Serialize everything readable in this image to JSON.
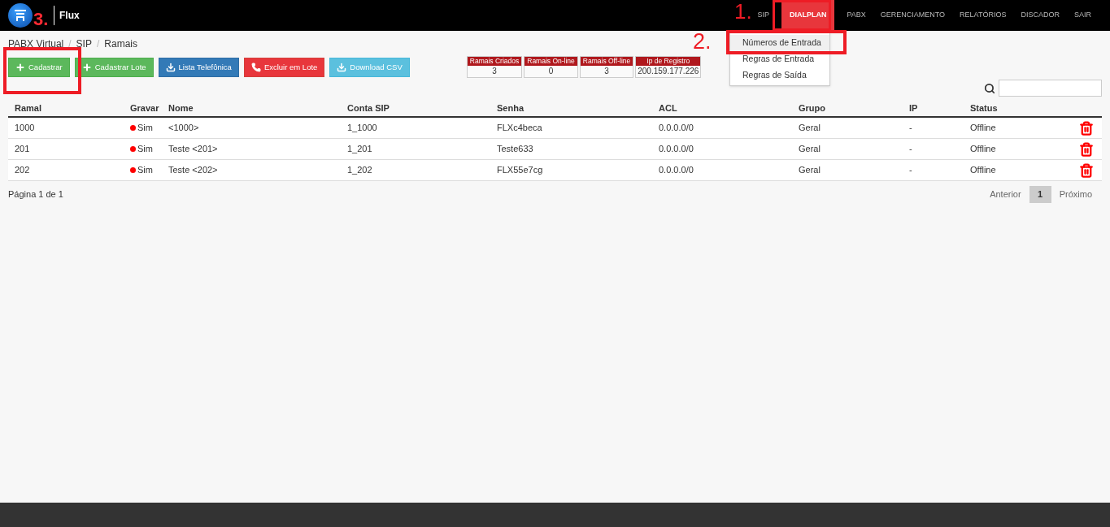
{
  "brand": "Flux",
  "nav": [
    {
      "label": "SIP",
      "selected": false
    },
    {
      "label": "DIALPLAN",
      "selected": true
    },
    {
      "label": "PABX",
      "selected": false
    },
    {
      "label": "GERENCIAMENTO",
      "selected": false
    },
    {
      "label": "RELATÓRIOS",
      "selected": false
    },
    {
      "label": "DISCADOR",
      "selected": false
    },
    {
      "label": "SAIR",
      "selected": false
    }
  ],
  "dropdown": [
    {
      "label": "Números de Entrada",
      "selected": true
    },
    {
      "label": "Regras de Entrada",
      "selected": false
    },
    {
      "label": "Regras de Saída",
      "selected": false
    }
  ],
  "breadcrumb": [
    "PABX Virtual",
    "SIP",
    "Ramais"
  ],
  "breadcrumb_separator": "/",
  "buttons": [
    {
      "label": "Cadastrar",
      "kind": "add"
    },
    {
      "label": "Cadastrar Lote",
      "kind": "add"
    },
    {
      "label": "Lista Telefônica",
      "kind": "list"
    },
    {
      "label": "Excluir em Lote",
      "kind": "delete"
    },
    {
      "label": "Download CSV",
      "kind": "download"
    }
  ],
  "stats": [
    {
      "label": "Ramais Criados",
      "value": "3"
    },
    {
      "label": "Ramais On-line",
      "value": "0"
    },
    {
      "label": "Ramais Off-line",
      "value": "3"
    },
    {
      "label": "Ip de Registro",
      "value": "200.159.177.226"
    }
  ],
  "table": {
    "columns": [
      "Ramal",
      "Gravar",
      "Nome",
      "Conta SIP",
      "Senha",
      "ACL",
      "Grupo",
      "IP",
      "Status"
    ],
    "rows": [
      {
        "cells": [
          "1000",
          "Sim",
          "<1000>",
          "1_1000",
          "FLXc4beca",
          "0.0.0.0/0",
          "Geral",
          "-",
          "Offline"
        ],
        "recording": true
      },
      {
        "cells": [
          "201",
          "Sim",
          "Teste <201>",
          "1_201",
          "Teste633",
          "0.0.0.0/0",
          "Geral",
          "-",
          "Offline"
        ],
        "recording": true
      },
      {
        "cells": [
          "202",
          "Sim",
          "Teste <202>",
          "1_202",
          "FLX55e7cg",
          "0.0.0.0/0",
          "Geral",
          "-",
          "Offline"
        ],
        "recording": true
      }
    ]
  },
  "page_info": "Página 1 de 1",
  "pagination": {
    "previous": "Anterior",
    "pages": [
      {
        "label": "1",
        "selected": true
      }
    ],
    "next": "Próximo"
  },
  "annotations": [
    "1.",
    "2.",
    "3."
  ]
}
